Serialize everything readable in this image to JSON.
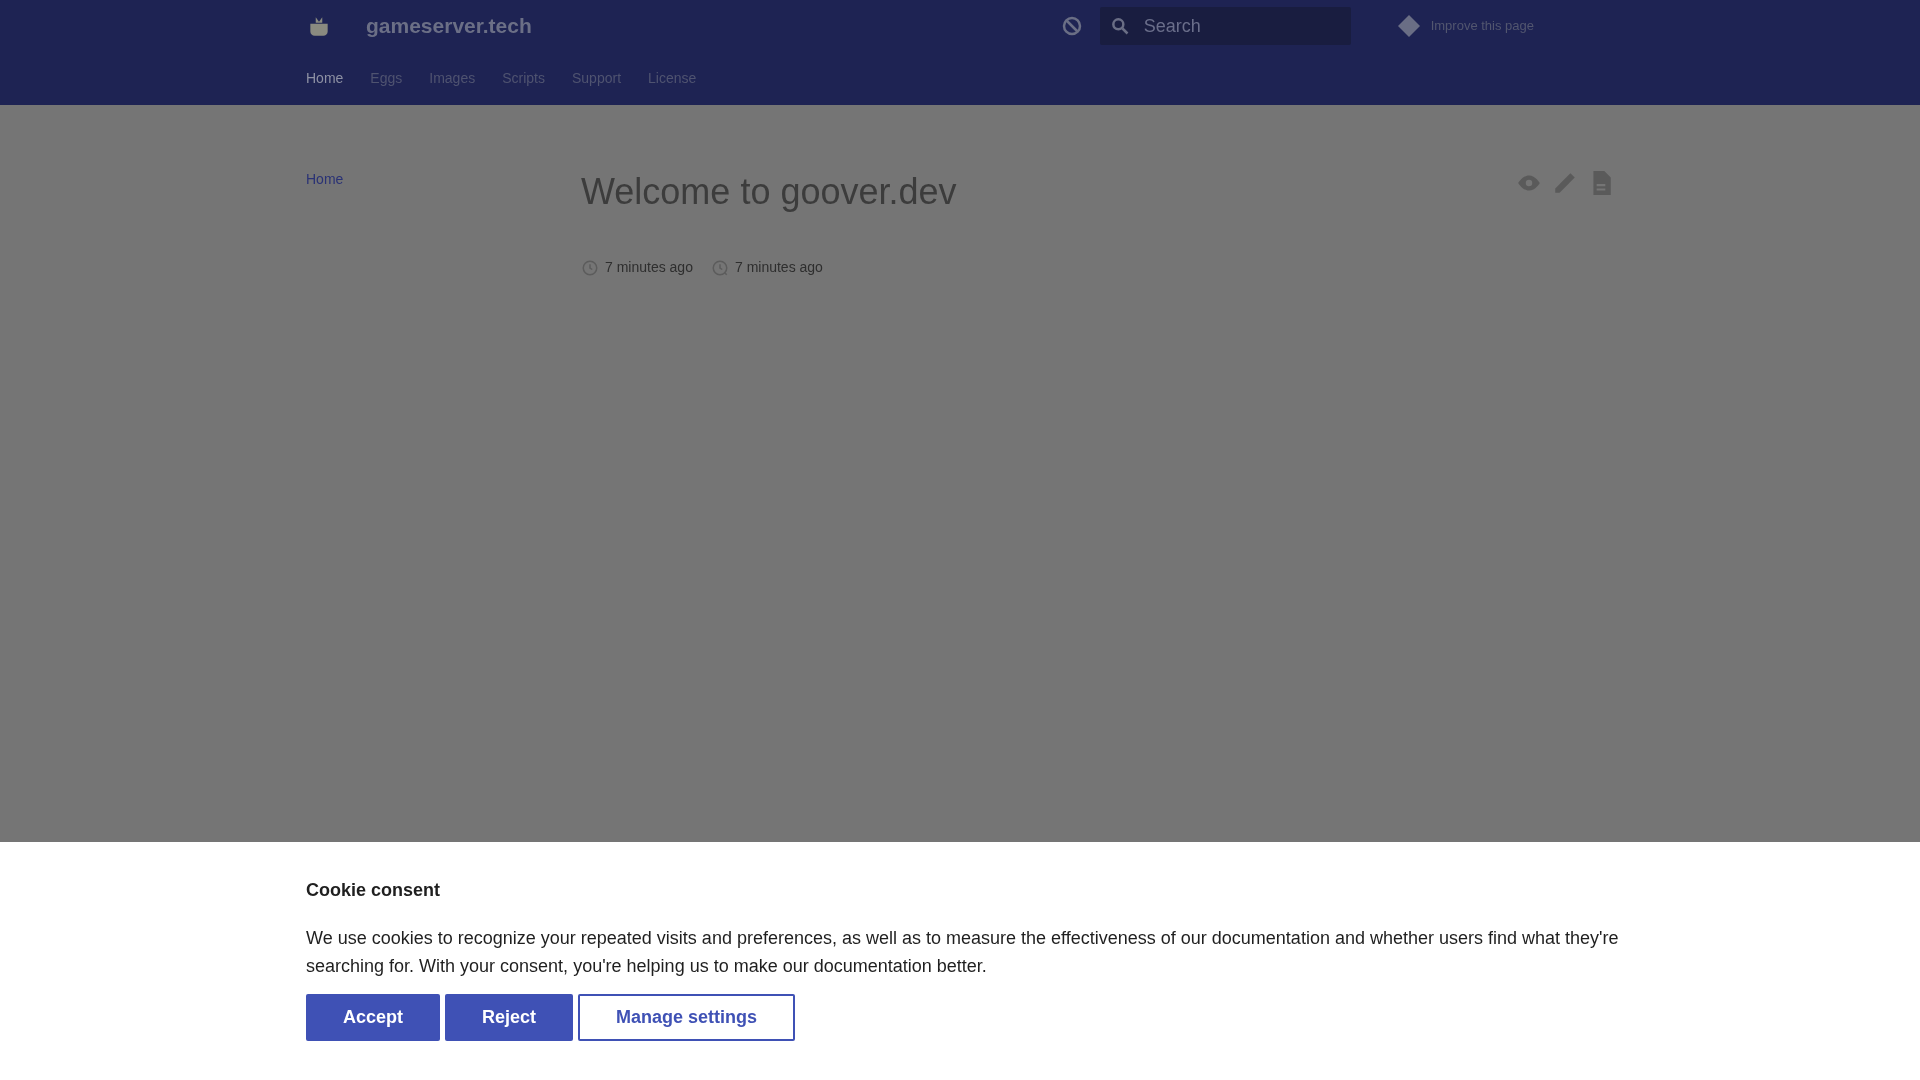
{
  "header": {
    "site_title": "gameserver.tech",
    "search": {
      "placeholder": "Search"
    },
    "repo_link": "Improve this page"
  },
  "tabs": [
    {
      "label": "Home",
      "selected": true
    },
    {
      "label": "Eggs",
      "selected": false
    },
    {
      "label": "Images",
      "selected": false
    },
    {
      "label": "Scripts",
      "selected": false
    },
    {
      "label": "Support",
      "selected": false
    },
    {
      "label": "License",
      "selected": false
    }
  ],
  "sidebar": {
    "items": [
      {
        "label": "Home",
        "selected": true
      }
    ]
  },
  "content": {
    "title": "Welcome to goover.dev",
    "meta": [
      {
        "kind": "created",
        "text": "7 minutes ago"
      },
      {
        "kind": "updated",
        "text": "7 minutes ago"
      }
    ]
  },
  "cookie_consent": {
    "title": "Cookie consent",
    "text": "We use cookies to recognize your repeated visits and preferences, as well as to measure the effectiveness of our documentation and whether users find what they're searching for. With your consent, you're helping us to make our documentation better.",
    "buttons": [
      {
        "label": "Accept",
        "kind": "primary"
      },
      {
        "label": "Reject",
        "kind": "primary"
      },
      {
        "label": "Manage settings",
        "kind": "outline"
      }
    ]
  }
}
